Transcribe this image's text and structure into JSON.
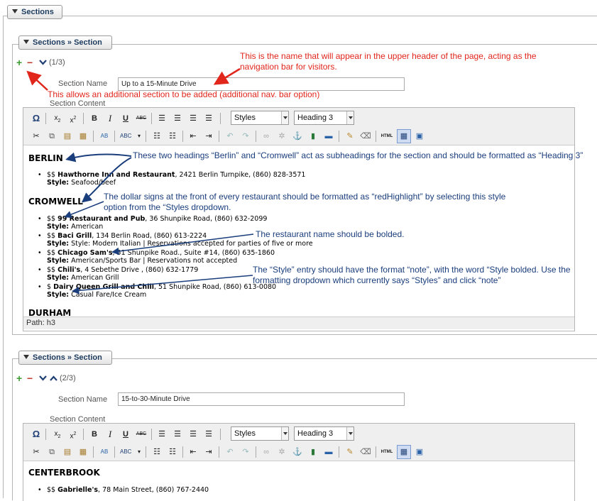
{
  "header_tab": "Sections",
  "section_tab": "Sections » Section",
  "section1": {
    "counter": "(1/3)",
    "name_label": "Section Name",
    "name_value": "Up to a 15-Minute Drive",
    "content_label": "Section Content",
    "styles_select": "Styles",
    "format_select": "Heading 3",
    "cities": [
      "BERLIN",
      "CROMWELL",
      "DURHAM"
    ],
    "berlin_entries": [
      {
        "price": "$$",
        "name": "Hawthorne Inn and Restaurant",
        "rest": ", 2421 Berlin Turnpike, (860) 828-3571",
        "style_label": "Style:",
        "style_value": " Seafood/beef"
      }
    ],
    "cromwell_entries": [
      {
        "price": "$$",
        "name": "99 Restaurant and Pub",
        "rest": ", 36 Shunpike Road, (860) 632-2099",
        "style_label": "Style:",
        "style_value": " American"
      },
      {
        "price": "$$",
        "name": "Baci Grill",
        "rest": ", 134 Berlin Road, (860) 613-2224",
        "style_label": "Style:",
        "style_value": " Style: Modern Italian | Reservations accepted for parties of five or more"
      },
      {
        "price": "$$",
        "name": "Chicago Sam's",
        "rest": ", 51 Shunpike Road., Suite #14, (860) 635-1860",
        "style_label": "Style:",
        "style_value": " American/Sports Bar | Reservations not accepted"
      },
      {
        "price": "$$",
        "name": "Chili's",
        "rest": ", 4 Sebethe Drive , (860) 632-1779",
        "style_label": "Style:",
        "style_value": " American Grill"
      },
      {
        "price": "$",
        "name": "Dairy Queen Grill and Chill",
        "rest": ", 51 Shunpike Road, (860) 613-0080",
        "style_label": "Style:",
        "style_value": " Casual Fare/Ice Cream"
      }
    ],
    "path": "Path: h3"
  },
  "section2": {
    "counter": "(2/3)",
    "name_label": "Section Name",
    "name_value": "15-to-30-Minute Drive",
    "content_label": "Section Content",
    "styles_select": "Styles",
    "format_select": "Heading 3",
    "city": "CENTERBROOK",
    "entry": {
      "price": "$$",
      "name": "Gabrielle's",
      "rest": ", 78 Main Street, (860) 767-2440"
    }
  },
  "annotations": {
    "name_note": "This is the name that will appear in the upper header of the page, acting as the navigation bar for visitors.",
    "add_note": "This allows an additional section to be added (additional nav. bar option)",
    "heading_note": "These two headings “Berlin” and “Cromwell” act as subheadings for the section and should be formatted as “Heading 3”",
    "dollar_note": "The dollar signs at the front of every restaurant should be formatted as “redHighlight” by selecting this style option from the “Styles dropdown.",
    "bold_note": "The restaurant name should be bolded.",
    "style_note": "The “Style” entry should have the format “note”, with the word “Style bolded. Use the formatting dropdown which currently says “Styles” and click “note”"
  },
  "colors": {
    "annotation_red": "#e1261c",
    "annotation_blue": "#1a3d7c",
    "add_green": "#3a9b2f"
  }
}
